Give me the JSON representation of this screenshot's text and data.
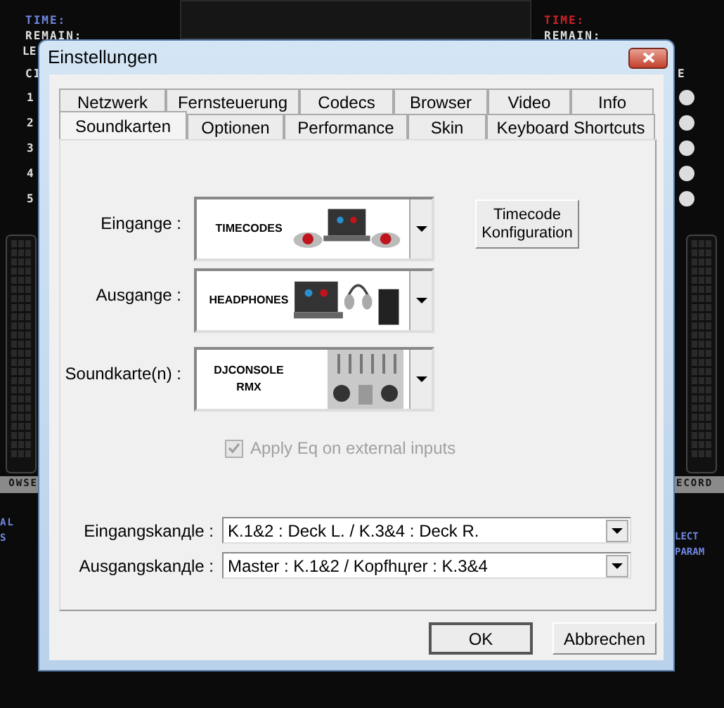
{
  "deck_left": {
    "time_label": "TIME:",
    "remain_label": "REMAIN:",
    "cut_label": "LE",
    "list_label": "CI",
    "rows": [
      "1",
      "2",
      "3",
      "4",
      "5"
    ],
    "tab": "OWSE",
    "info_lines": [
      "AL",
      "S"
    ]
  },
  "deck_right": {
    "time_label": "TIME:",
    "remain_label": "REMAIN:",
    "list_label": "E",
    "tab": "ECORD",
    "info_lines": [
      "LECT",
      "PARAM"
    ]
  },
  "dialog": {
    "title": "Einstellungen",
    "tab_rows": [
      [
        {
          "label": "Netzwerk",
          "selected": false
        },
        {
          "label": "Fernsteuerung",
          "selected": false
        },
        {
          "label": "Codecs",
          "selected": false
        },
        {
          "label": "Browser",
          "selected": false
        },
        {
          "label": "Video",
          "selected": false
        },
        {
          "label": "Info",
          "selected": false
        }
      ],
      [
        {
          "label": "Soundkarten",
          "selected": true
        },
        {
          "label": "Optionen",
          "selected": false
        },
        {
          "label": "Performance",
          "selected": false
        },
        {
          "label": "Skin",
          "selected": false
        },
        {
          "label": "Keyboard Shortcuts",
          "selected": false
        }
      ]
    ],
    "devices": [
      {
        "kind": "timecodes",
        "label": "Eingange :",
        "image_text": "TIMECODES"
      },
      {
        "kind": "headphones",
        "label": "Ausgange :",
        "image_text": "HEADPHONES"
      },
      {
        "kind": "console",
        "label": "Soundkarte(n) :",
        "image_text": "DJCONSOLE RMX"
      }
    ],
    "timecode_button": "Timecode Konfiguration",
    "checkbox": {
      "label": "Apply Eq on external inputs",
      "checked": true,
      "disabled": true
    },
    "channels": [
      {
        "label": "Eingangskanдle :",
        "value": "K.1&2 : Deck L. / K.3&4 : Deck R."
      },
      {
        "label": "Ausgangskanдle :",
        "value": "Master : K.1&2 / Kopfhцrer : K.3&4"
      }
    ],
    "buttons": [
      {
        "label": "OK",
        "default": true
      },
      {
        "label": "Abbrechen",
        "default": false
      }
    ]
  }
}
